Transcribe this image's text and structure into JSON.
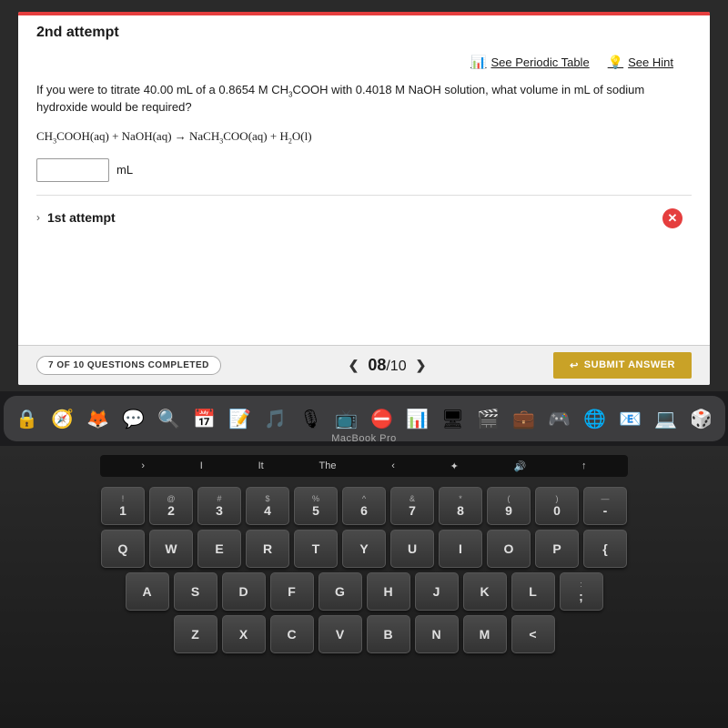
{
  "screen": {
    "top_bar_color": "#e53e3e",
    "attempt_title": "2nd attempt",
    "tools": {
      "periodic_table_label": "See Periodic Table",
      "hint_label": "See Hint"
    },
    "question": {
      "text": "If you were to titrate 40.00 mL of a 0.8654 M CH₃COOH with 0.4018 M NaOH solution, what volume in mL of sodium hydroxide would be required?",
      "equation": "CH₃COOH(aq) + NaOH(aq) → NaCH₃COO(aq) + H₂O(l)",
      "input_placeholder": "",
      "unit_label": "mL"
    },
    "prev_attempt": {
      "label": "1st attempt",
      "chevron": "›"
    },
    "bottom_bar": {
      "questions_progress": "7 OF 10 QUESTIONS COMPLETED",
      "page_current": "08",
      "page_total": "/10",
      "submit_label": "SUBMIT ANSWER"
    }
  },
  "dock": {
    "icons": [
      "🔒",
      "🧭",
      "🦊",
      "📱",
      "🔍",
      "📅",
      "📝",
      "🎵",
      "🎙",
      "📺",
      "⛔",
      "📊",
      "🖥",
      "🎬",
      "💼",
      "🎮",
      "🌐",
      "📧",
      "💻",
      "🎲"
    ]
  },
  "macbook_label": "MacBook Pro",
  "keyboard": {
    "touch_bar_keys": [
      ">",
      "I",
      "It",
      "The",
      "<",
      "✦",
      "🔊",
      "↑"
    ],
    "row1": [
      "!",
      "@",
      "#",
      "$",
      "%",
      "^",
      "&",
      "*",
      "(",
      ")",
      "—"
    ],
    "row1_sub": [
      "1",
      "2",
      "3",
      "4",
      "5",
      "6",
      "7",
      "8",
      "9",
      "0",
      ""
    ],
    "row2": [
      "Q",
      "W",
      "E",
      "R",
      "T",
      "Y",
      "U",
      "I",
      "O",
      "P",
      "{"
    ],
    "row3": [
      "A",
      "S",
      "D",
      "F",
      "G",
      "H",
      "J",
      "K",
      "L",
      ":"
    ],
    "row4": [
      "Z",
      "X",
      "C",
      "V",
      "B",
      "N",
      "M",
      "<"
    ]
  }
}
